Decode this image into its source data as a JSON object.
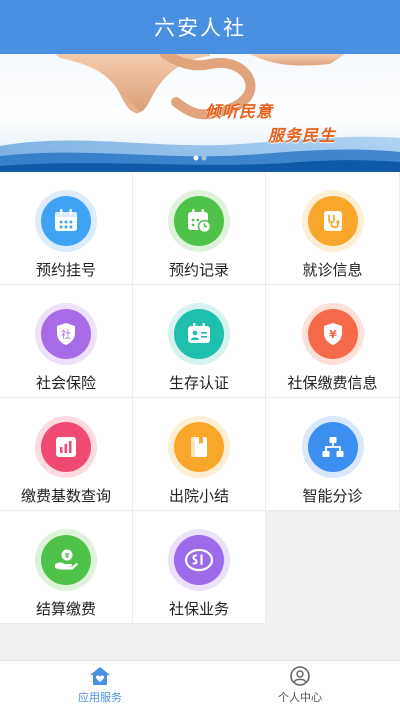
{
  "header": {
    "title": "六安人社"
  },
  "banner": {
    "slogan_line1": "倾听民意",
    "slogan_line2": "服务民生"
  },
  "grid": {
    "items": [
      {
        "label": "预约挂号",
        "icon": "calendar-icon",
        "color": "#3fa3f5"
      },
      {
        "label": "预约记录",
        "icon": "calendar-clock-icon",
        "color": "#4fc24a"
      },
      {
        "label": "就诊信息",
        "icon": "stethoscope-icon",
        "color": "#f8a72a"
      },
      {
        "label": "社会保险",
        "icon": "shield-she-icon",
        "color": "#a86be8"
      },
      {
        "label": "生存认证",
        "icon": "id-card-icon",
        "color": "#1fbfad"
      },
      {
        "label": "社保缴费信息",
        "icon": "shield-yen-icon",
        "color": "#f56a4a"
      },
      {
        "label": "缴费基数查询",
        "icon": "bar-chart-icon",
        "color": "#f04a72"
      },
      {
        "label": "出院小结",
        "icon": "book-icon",
        "color": "#f8a72a"
      },
      {
        "label": "智能分诊",
        "icon": "hierarchy-icon",
        "color": "#3a8ff0"
      },
      {
        "label": "结算缴费",
        "icon": "hand-coin-icon",
        "color": "#4fc24a"
      },
      {
        "label": "社保业务",
        "icon": "si-logo-icon",
        "color": "#9b6bea"
      }
    ]
  },
  "tabbar": {
    "tabs": [
      {
        "label": "应用服务",
        "icon": "home-heart-icon",
        "active": true
      },
      {
        "label": "个人中心",
        "icon": "user-icon",
        "active": false
      }
    ]
  },
  "colors": {
    "header_bg": "#4a90e2",
    "active_tab": "#4a90e2",
    "slogan": "#e8601c"
  }
}
